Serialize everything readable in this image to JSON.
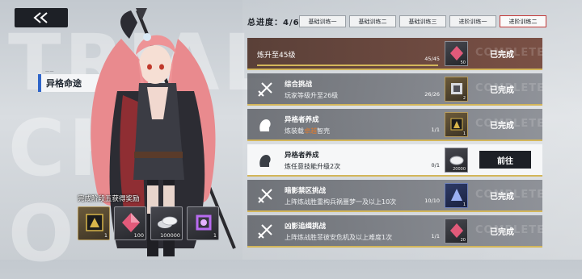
{
  "header": {
    "progress_label": "总进度：",
    "progress_value": "4/6",
    "tabs": [
      "基础训练一",
      "基础训练二",
      "基础训练三",
      "进阶训练一",
      "进阶训练二"
    ],
    "active_tab": 4
  },
  "mode": {
    "small_label": "一一",
    "title": "异格命途"
  },
  "background_text": [
    "TRIAL",
    "CH",
    "O"
  ],
  "rewards": {
    "title": "完成阶段五获得奖励",
    "items": [
      {
        "name": "chip",
        "qty": "1"
      },
      {
        "name": "crystal",
        "qty": "100"
      },
      {
        "name": "coins",
        "qty": "100000"
      },
      {
        "name": "frame",
        "qty": "1"
      }
    ]
  },
  "tasks": [
    {
      "title": "",
      "desc": "",
      "single": "炼升至45级",
      "count": "45/45",
      "progress": 1.0,
      "reward_qty": "50",
      "status": "已完成"
    },
    {
      "title": "综合挑战",
      "desc": "玩家等级升至26级",
      "count": "26/26",
      "progress": 1.0,
      "reward_qty": "2",
      "status": "已完成"
    },
    {
      "title": "异格者养成",
      "desc_pre": "炼装载",
      "desc_hl": "卓越",
      "desc_post": "智壳",
      "count": "1/1",
      "progress": 1.0,
      "reward_qty": "1",
      "status": "已完成"
    },
    {
      "title": "异格者养成",
      "desc": "炼任意技能升级2次",
      "count": "0/1",
      "progress": 0.0,
      "reward_qty": "20000",
      "status": "前往"
    },
    {
      "title": "暗影禁区挑战",
      "desc": "上阵炼战胜重构兵祸噩梦一及以上10次",
      "count": "10/10",
      "progress": 1.0,
      "reward_qty": "1",
      "status": "已完成"
    },
    {
      "title": "凶影追缉挑战",
      "desc": "上阵炼战胜菲彼安危机及以上难度1次",
      "count": "1/1",
      "progress": 1.0,
      "reward_qty": "20",
      "status": "已完成"
    }
  ],
  "watermark": "COMPLETE",
  "colors": {
    "accent_gold": "#d3b65a",
    "accent_red": "#c23a3a",
    "accent_blue": "#2f65c9"
  }
}
